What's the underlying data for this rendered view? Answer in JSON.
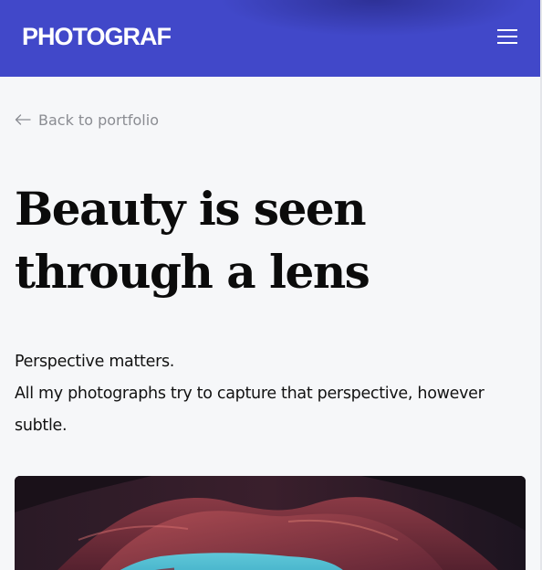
{
  "header": {
    "logo": "PHOTOGRAF",
    "menu_icon": "hamburger-menu-icon",
    "background_color": "#4148c9"
  },
  "back_link": {
    "label": "Back to portfolio",
    "icon": "arrow-left-icon"
  },
  "title": {
    "line1": "Beauty is seen",
    "line2": "through a lens"
  },
  "intro": {
    "line1": "Perspective matters.",
    "line2": "All my photographs try to capture that perspective, however subtle."
  },
  "hero_image": {
    "subject": "canyon-rock-arch-photo"
  }
}
